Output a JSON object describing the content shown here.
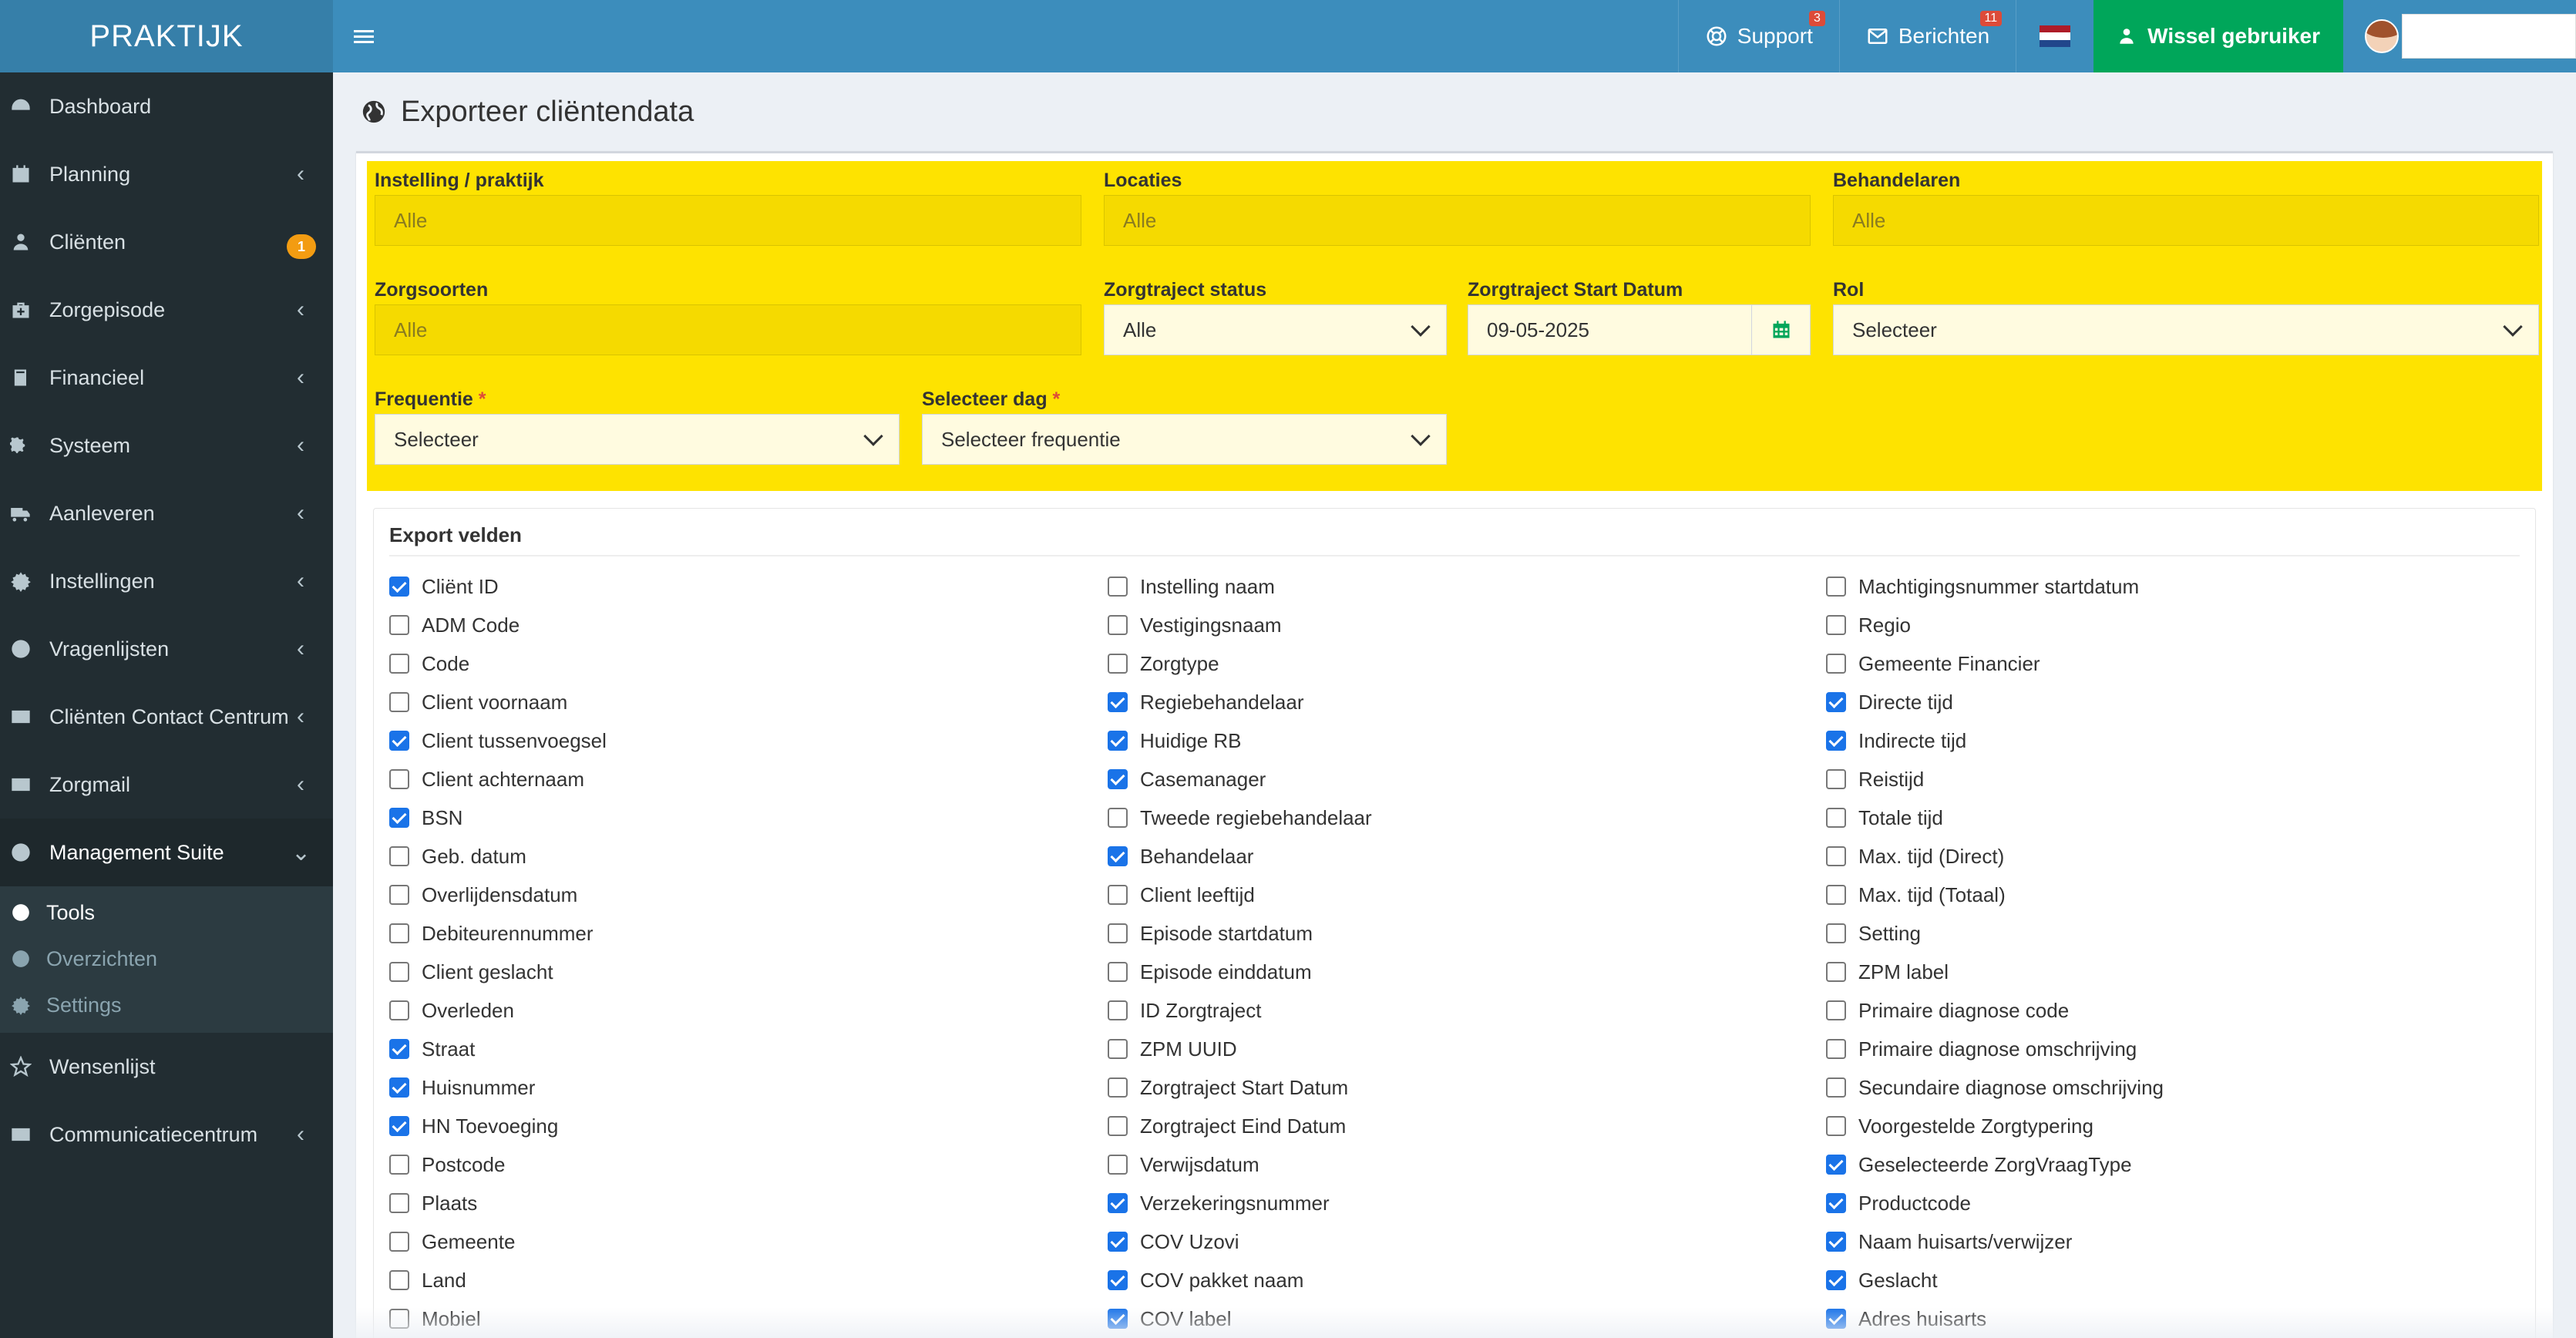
{
  "app": {
    "logo": "PRAKTIJK"
  },
  "sidebar": {
    "items": [
      {
        "label": "Dashboard",
        "icon": "dashboard-icon",
        "chevron": ""
      },
      {
        "label": "Planning",
        "icon": "calendar-icon",
        "chevron": "‹"
      },
      {
        "label": "Cliënten",
        "icon": "user-icon",
        "badge": "1",
        "chevron": ""
      },
      {
        "label": "Zorgepisode",
        "icon": "medkit-icon",
        "chevron": "‹"
      },
      {
        "label": "Financieel",
        "icon": "book-icon",
        "chevron": "‹"
      },
      {
        "label": "Systeem",
        "icon": "gears-icon",
        "chevron": "‹"
      },
      {
        "label": "Aanleveren",
        "icon": "truck-icon",
        "chevron": "‹"
      },
      {
        "label": "Instellingen",
        "icon": "gear-icon",
        "chevron": "‹"
      },
      {
        "label": "Vragenlijsten",
        "icon": "globe-icon",
        "chevron": "‹"
      },
      {
        "label": "Cliënten Contact Centrum",
        "icon": "envelope-icon",
        "chevron": "‹"
      },
      {
        "label": "Zorgmail",
        "icon": "envelope-icon",
        "chevron": "‹"
      },
      {
        "label": "Management Suite",
        "icon": "globe-icon",
        "chevron": "⌄"
      }
    ],
    "subitems": [
      {
        "label": "Tools",
        "icon": "globe-icon"
      },
      {
        "label": "Overzichten",
        "icon": "globe-icon"
      },
      {
        "label": "Settings",
        "icon": "gear-icon"
      }
    ],
    "after": [
      {
        "label": "Wensenlijst",
        "icon": "star-icon",
        "chevron": ""
      },
      {
        "label": "Communicatiecentrum",
        "icon": "envelope-icon",
        "chevron": "‹"
      }
    ]
  },
  "topbar": {
    "support": {
      "label": "Support",
      "badge": "3"
    },
    "messages": {
      "label": "Berichten",
      "badge": "11"
    },
    "switch_user": "Wissel gebruiker"
  },
  "page": {
    "title": "Exporteer cliëntendata"
  },
  "filters": {
    "instelling": {
      "label": "Instelling / praktijk",
      "placeholder": "Alle"
    },
    "locaties": {
      "label": "Locaties",
      "placeholder": "Alle"
    },
    "behandelaren": {
      "label": "Behandelaren",
      "placeholder": "Alle"
    },
    "zorgsoorten": {
      "label": "Zorgsoorten",
      "placeholder": "Alle"
    },
    "status": {
      "label": "Zorgtraject status",
      "value": "Alle"
    },
    "startdatum": {
      "label": "Zorgtraject Start Datum",
      "value": "09-05-2025"
    },
    "rol": {
      "label": "Rol",
      "value": "Selecteer"
    },
    "frequentie": {
      "label": "Frequentie",
      "required": "*",
      "value": "Selecteer"
    },
    "dag": {
      "label": "Selecteer dag",
      "required": "*",
      "value": "Selecteer frequentie"
    }
  },
  "export": {
    "heading": "Export velden",
    "columns": [
      [
        {
          "label": "Cliënt ID",
          "checked": true
        },
        {
          "label": "ADM Code",
          "checked": false
        },
        {
          "label": "Code",
          "checked": false
        },
        {
          "label": "Client voornaam",
          "checked": false
        },
        {
          "label": "Client tussenvoegsel",
          "checked": true
        },
        {
          "label": "Client achternaam",
          "checked": false
        },
        {
          "label": "BSN",
          "checked": true
        },
        {
          "label": "Geb. datum",
          "checked": false
        },
        {
          "label": "Overlijdensdatum",
          "checked": false
        },
        {
          "label": "Debiteurennummer",
          "checked": false
        },
        {
          "label": "Client geslacht",
          "checked": false
        },
        {
          "label": "Overleden",
          "checked": false
        },
        {
          "label": "Straat",
          "checked": true
        },
        {
          "label": "Huisnummer",
          "checked": true
        },
        {
          "label": "HN Toevoeging",
          "checked": true
        },
        {
          "label": "Postcode",
          "checked": false
        },
        {
          "label": "Plaats",
          "checked": false
        },
        {
          "label": "Gemeente",
          "checked": false
        },
        {
          "label": "Land",
          "checked": false
        },
        {
          "label": "Mobiel",
          "checked": false
        }
      ],
      [
        {
          "label": "Instelling naam",
          "checked": false
        },
        {
          "label": "Vestigingsnaam",
          "checked": false
        },
        {
          "label": "Zorgtype",
          "checked": false
        },
        {
          "label": "Regiebehandelaar",
          "checked": true
        },
        {
          "label": "Huidige RB",
          "checked": true
        },
        {
          "label": "Casemanager",
          "checked": true
        },
        {
          "label": "Tweede regiebehandelaar",
          "checked": false
        },
        {
          "label": "Behandelaar",
          "checked": true
        },
        {
          "label": "Client leeftijd",
          "checked": false
        },
        {
          "label": "Episode startdatum",
          "checked": false
        },
        {
          "label": "Episode einddatum",
          "checked": false
        },
        {
          "label": "ID Zorgtraject",
          "checked": false
        },
        {
          "label": "ZPM UUID",
          "checked": false
        },
        {
          "label": "Zorgtraject Start Datum",
          "checked": false
        },
        {
          "label": "Zorgtraject Eind Datum",
          "checked": false
        },
        {
          "label": "Verwijsdatum",
          "checked": false
        },
        {
          "label": "Verzekeringsnummer",
          "checked": true
        },
        {
          "label": "COV Uzovi",
          "checked": true
        },
        {
          "label": "COV pakket naam",
          "checked": true
        },
        {
          "label": "COV label",
          "checked": true
        }
      ],
      [
        {
          "label": "Machtigingsnummer startdatum",
          "checked": false
        },
        {
          "label": "Regio",
          "checked": false
        },
        {
          "label": "Gemeente Financier",
          "checked": false
        },
        {
          "label": "Directe tijd",
          "checked": true
        },
        {
          "label": "Indirecte tijd",
          "checked": true
        },
        {
          "label": "Reistijd",
          "checked": false
        },
        {
          "label": "Totale tijd",
          "checked": false
        },
        {
          "label": "Max. tijd (Direct)",
          "checked": false
        },
        {
          "label": "Max. tijd (Totaal)",
          "checked": false
        },
        {
          "label": "Setting",
          "checked": false
        },
        {
          "label": "ZPM label",
          "checked": false
        },
        {
          "label": "Primaire diagnose code",
          "checked": false
        },
        {
          "label": "Primaire diagnose omschrijving",
          "checked": false
        },
        {
          "label": "Secundaire diagnose omschrijving",
          "checked": false
        },
        {
          "label": "Voorgestelde Zorgtypering",
          "checked": false
        },
        {
          "label": "Geselecteerde ZorgVraagType",
          "checked": true
        },
        {
          "label": "Productcode",
          "checked": true
        },
        {
          "label": "Naam huisarts/verwijzer",
          "checked": true
        },
        {
          "label": "Geslacht",
          "checked": true
        },
        {
          "label": "Adres huisarts",
          "checked": true
        }
      ]
    ]
  },
  "colors": {
    "topbar": "#3c8dbc",
    "sidebar": "#222d32",
    "filters_bg": "#fee300",
    "switch_user": "#00a65a",
    "checkbox": "#1a73e8"
  }
}
